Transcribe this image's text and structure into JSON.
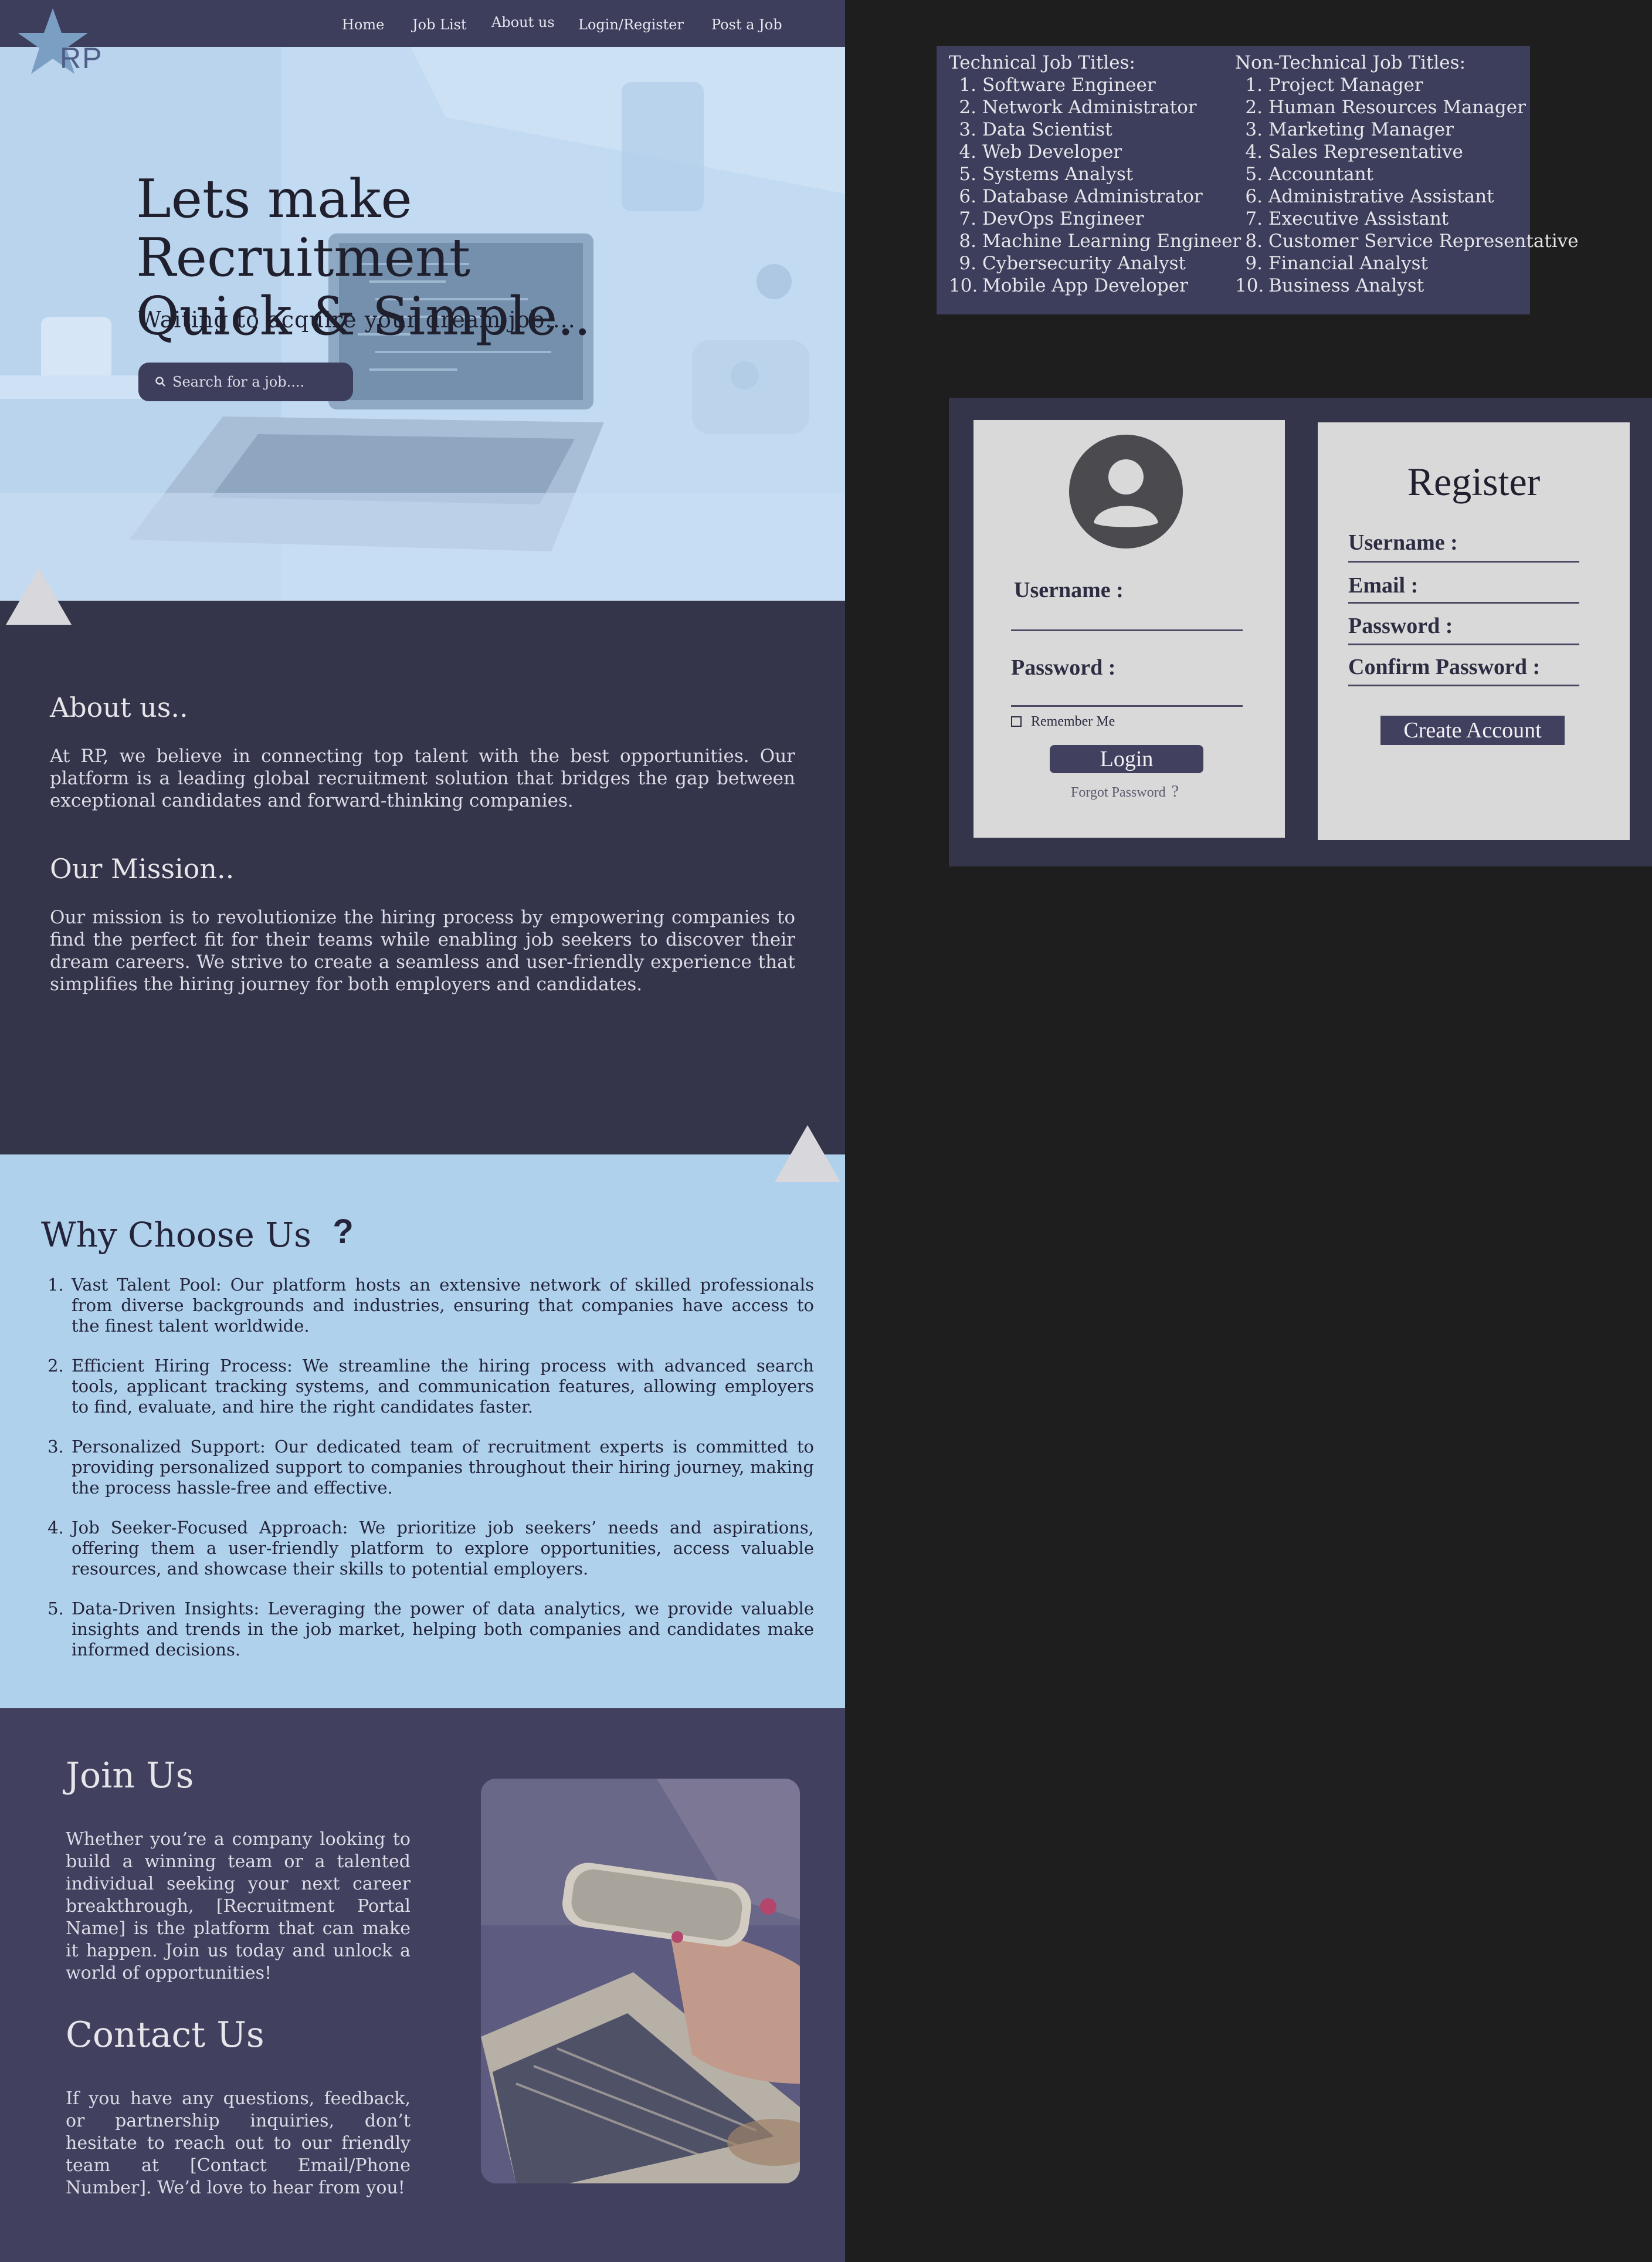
{
  "nav": {
    "logo_text": "RP",
    "links": [
      "Home",
      "Job List",
      "About us",
      "Login/Register",
      "Post a Job"
    ]
  },
  "hero": {
    "title_line1": "Lets make Recruitment",
    "title_line2": "Quick & Simple..",
    "subtitle": "Waiting to acquire your dream job....",
    "search_placeholder": "Search for a job...."
  },
  "about": {
    "heading": "About us..",
    "text": "At RP, we believe in connecting top talent with the best opportunities. Our platform is a leading global recruitment solution that bridges the gap between exceptional candidates and forward-thinking companies.",
    "mission_heading": "Our Mission..",
    "mission_text": "Our mission is to revolutionize the hiring process by empowering companies to find the perfect fit for their teams while enabling job seekers to discover their dream careers. We strive to create a seamless and user-friendly experience that simplifies the hiring journey for both employers and candidates."
  },
  "why": {
    "heading": "Why Choose Us",
    "question_mark": "?",
    "items": [
      "Vast Talent Pool: Our platform hosts an extensive network of skilled professionals from diverse backgrounds and industries, ensuring that companies have access to the finest talent worldwide.",
      "Efficient Hiring Process: We streamline the hiring process with advanced search tools, applicant tracking systems, and communication features, allowing employers to find, evaluate, and hire the right candidates faster.",
      "Personalized Support: Our dedicated team of recruitment experts is committed to providing personalized support to companies throughout their hiring journey, making the process hassle-free and effective.",
      "Job Seeker-Focused Approach: We prioritize job seekers’ needs and aspirations, offering them a user-friendly platform to explore opportunities, access valuable resources, and showcase their skills to potential employers.",
      "Data-Driven Insights: Leveraging the power of data analytics, we provide valuable insights and trends in the job market, helping both companies and candidates make informed decisions."
    ]
  },
  "join": {
    "heading": "Join Us",
    "text": "Whether you’re a company looking to build a winning team or a talented individual seeking your next career breakthrough, [Recruitment Portal Name] is the platform that can make it happen. Join us today and unlock a world of opportunities!",
    "contact_heading": "Contact Us",
    "contact_text": "If you have any questions, feedback, or partnership inquiries, don’t hesitate to reach out to our friendly team at [Contact Email/Phone Number]. We’d love to hear from you!"
  },
  "jobs": {
    "technical_heading": "Technical Job Titles:",
    "technical": [
      "Software Engineer",
      "Network Administrator",
      "Data Scientist",
      "Web Developer",
      "Systems Analyst",
      "Database Administrator",
      "DevOps Engineer",
      "Machine Learning Engineer",
      "Cybersecurity Analyst",
      "Mobile App Developer"
    ],
    "nontechnical_heading": "Non-Technical Job Titles:",
    "nontechnical": [
      "Project Manager",
      "Human Resources Manager",
      "Marketing Manager",
      "Sales Representative",
      "Accountant",
      "Administrative Assistant",
      "Executive Assistant",
      "Customer Service Representative",
      "Financial Analyst",
      "Business Analyst"
    ]
  },
  "login": {
    "username_label": "Username :",
    "password_label": "Password :",
    "remember_label": "Remember Me",
    "login_button": "Login",
    "forgot_label": "Forgot Password",
    "forgot_q": "?"
  },
  "register": {
    "title": "Register",
    "username_label": "Username :",
    "email_label": "Email :",
    "password_label": "Password :",
    "confirm_label": "Confirm Password :",
    "create_button": "Create Account"
  },
  "colors": {
    "navy": "#3d3d5c",
    "dark_section": "#34344a",
    "hero_blue": "#bcd8f3",
    "why_blue": "#afd1ec",
    "card_grey": "#d9d9d9",
    "page_bg": "#1e1e1e"
  },
  "icons": [
    "logo-star-icon",
    "search-icon",
    "user-avatar-icon",
    "checkbox-icon"
  ]
}
